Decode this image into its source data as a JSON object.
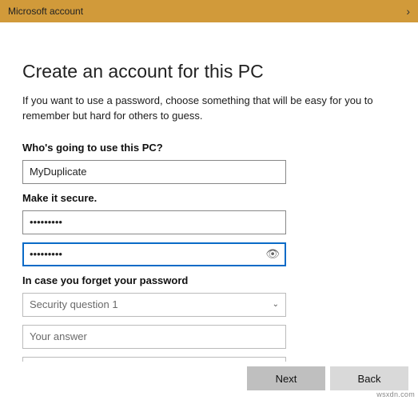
{
  "window": {
    "title": "Microsoft account"
  },
  "heading": "Create an account for this PC",
  "description": "If you want to use a password, choose something that will be easy for you to remember but hard for others to guess.",
  "section_user": {
    "label": "Who's going to use this PC?",
    "username_value": "MyDuplicate"
  },
  "section_secure": {
    "label": "Make it secure.",
    "password1_mask": "•••••••••",
    "password2_mask": "•••••••••"
  },
  "section_forgot": {
    "label": "In case you forget your password",
    "security_q_placeholder": "Security question 1",
    "answer_placeholder": "Your answer"
  },
  "buttons": {
    "next": "Next",
    "back": "Back"
  },
  "watermark": "wsxdn.com"
}
